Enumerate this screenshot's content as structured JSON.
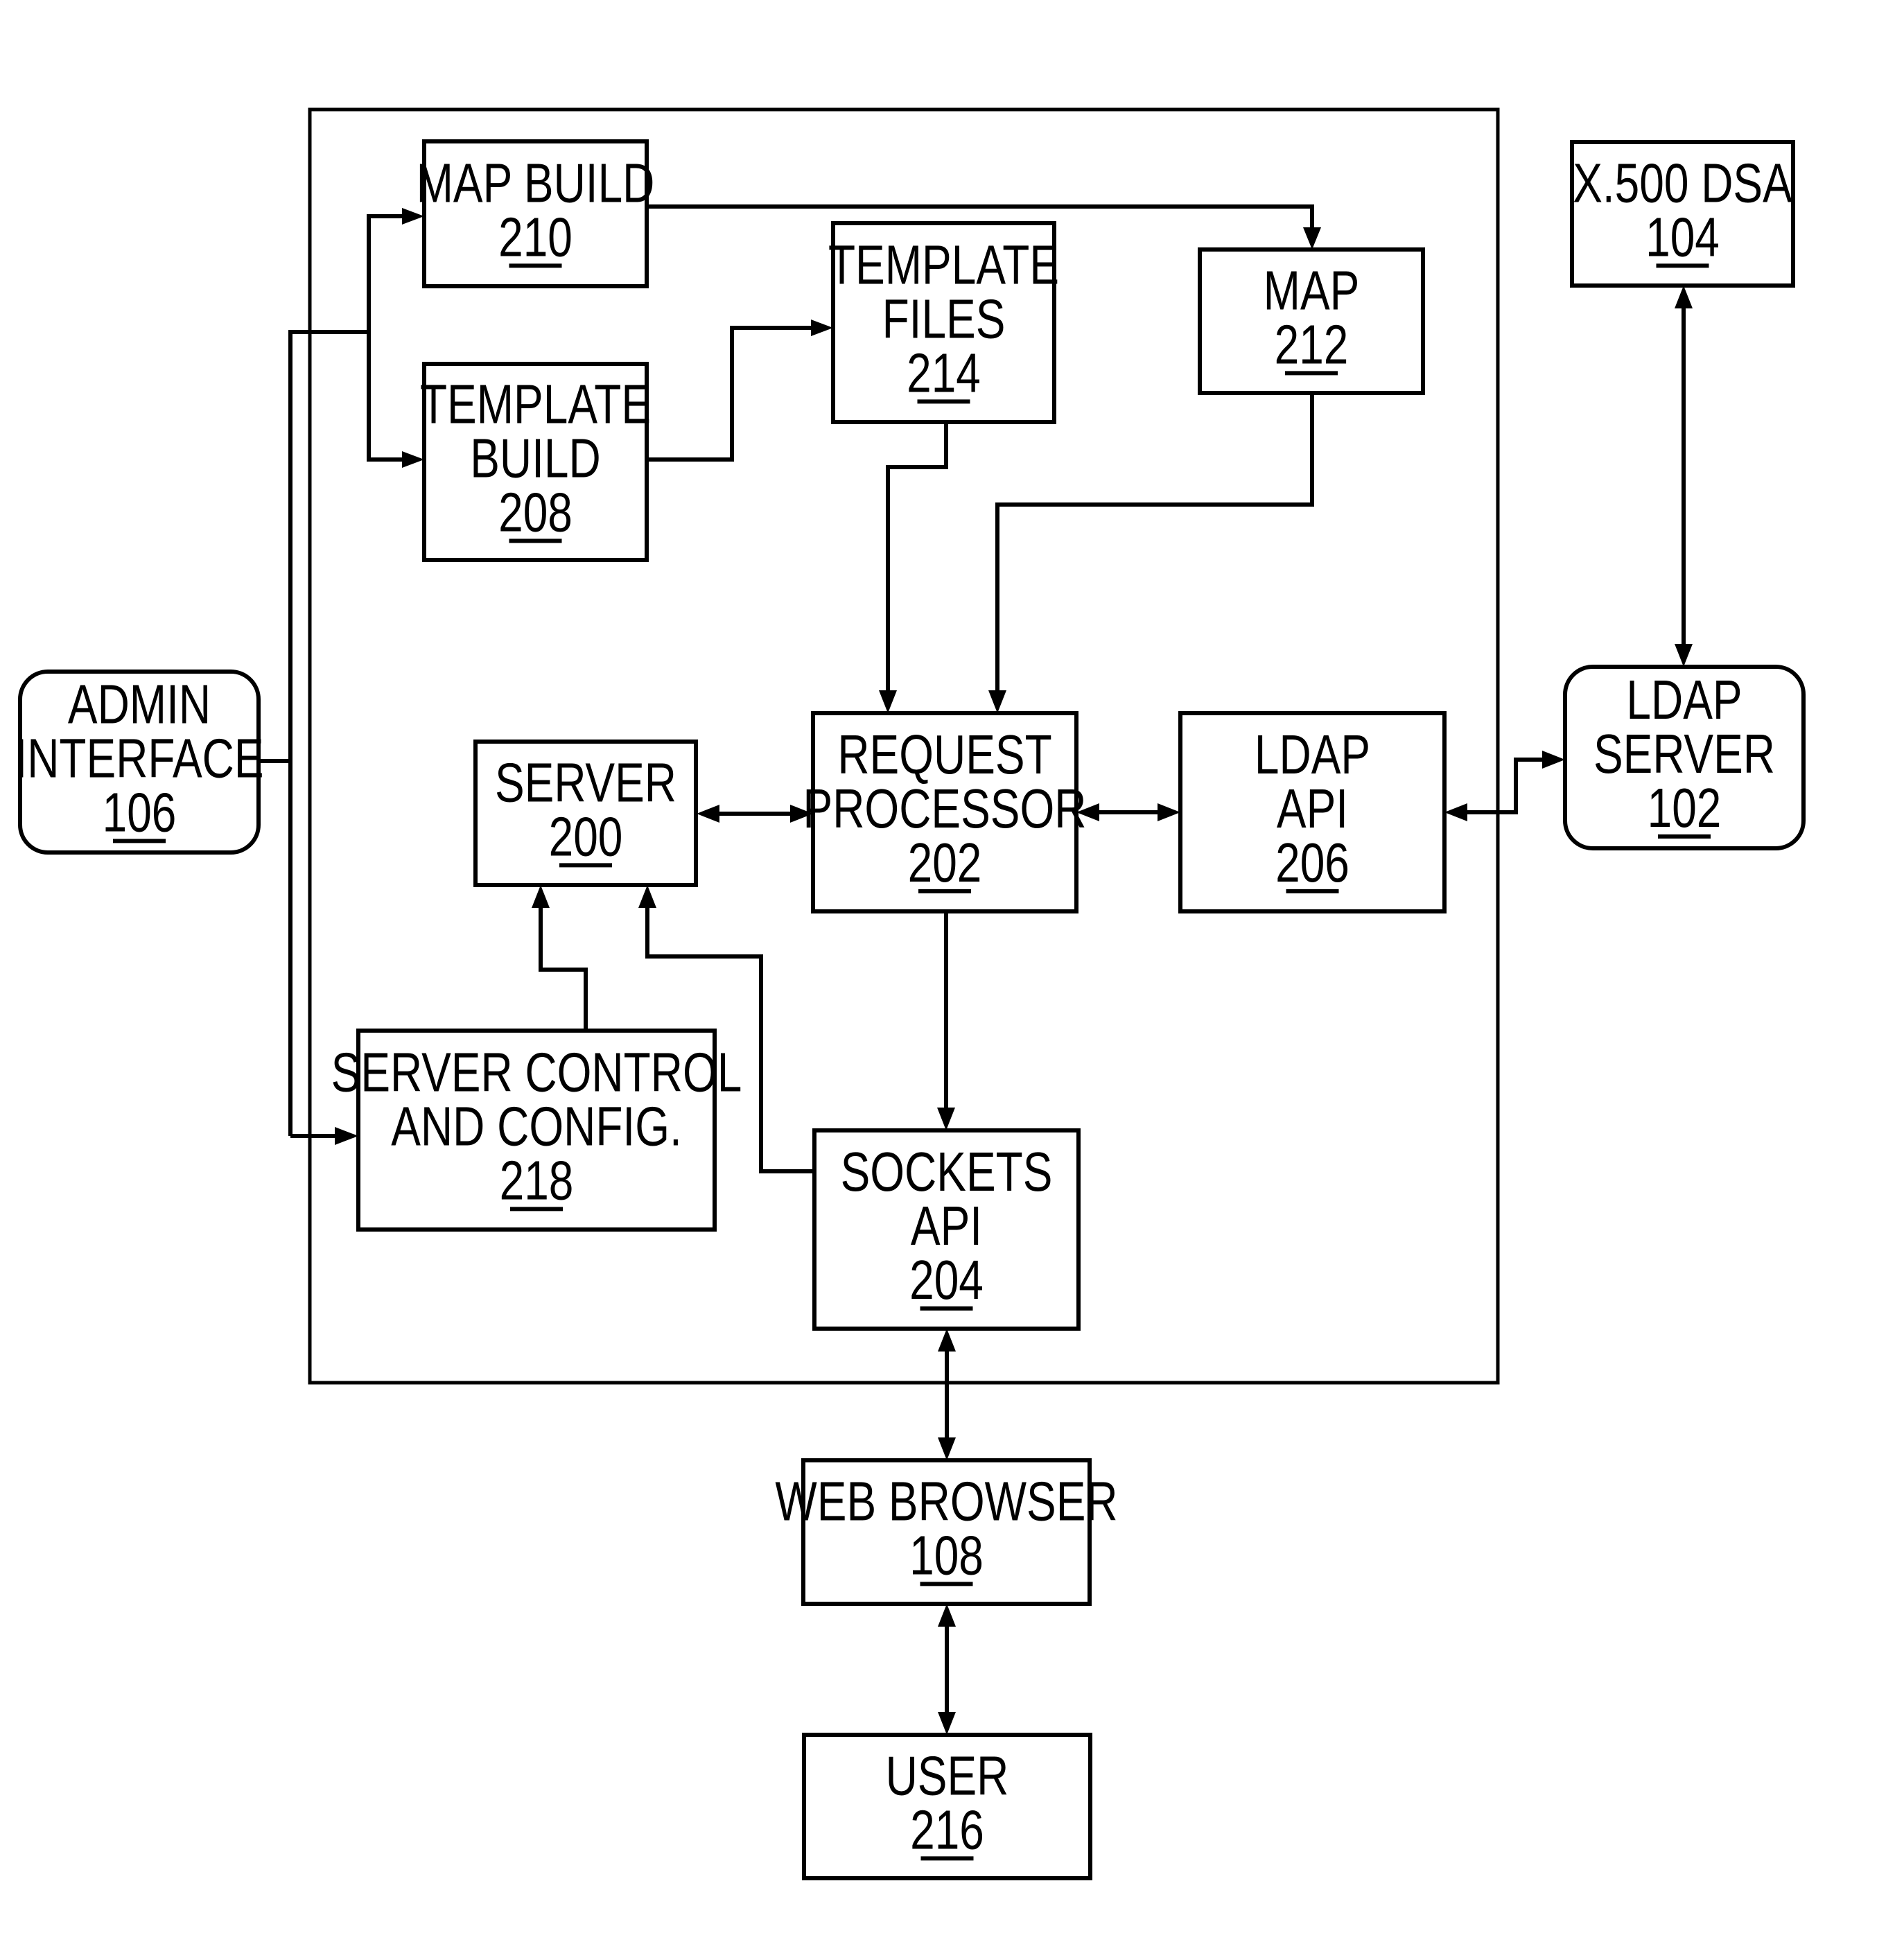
{
  "diagram": {
    "type": "block-diagram",
    "blocks": [
      {
        "id": "map_build",
        "lines": [
          "MAP BUILD"
        ],
        "ref": "210",
        "shape": "rect"
      },
      {
        "id": "template_build",
        "lines": [
          "TEMPLATE",
          "BUILD"
        ],
        "ref": "208",
        "shape": "rect"
      },
      {
        "id": "template_files",
        "lines": [
          "TEMPLATE",
          "FILES"
        ],
        "ref": "214",
        "shape": "rect"
      },
      {
        "id": "map",
        "lines": [
          "MAP"
        ],
        "ref": "212",
        "shape": "rect"
      },
      {
        "id": "x500_dsa",
        "lines": [
          "X.500 DSA"
        ],
        "ref": "104",
        "shape": "rect"
      },
      {
        "id": "admin_interface",
        "lines": [
          "ADMIN",
          "INTERFACE"
        ],
        "ref": "106",
        "shape": "rounded"
      },
      {
        "id": "server",
        "lines": [
          "SERVER"
        ],
        "ref": "200",
        "shape": "rect"
      },
      {
        "id": "request_processor",
        "lines": [
          "REQUEST",
          "PROCESSOR"
        ],
        "ref": "202",
        "shape": "rect"
      },
      {
        "id": "ldap_api",
        "lines": [
          "LDAP",
          "API"
        ],
        "ref": "206",
        "shape": "rect"
      },
      {
        "id": "ldap_server",
        "lines": [
          "LDAP",
          "SERVER"
        ],
        "ref": "102",
        "shape": "rounded"
      },
      {
        "id": "server_control",
        "lines": [
          "SERVER CONTROL",
          "AND CONFIG."
        ],
        "ref": "218",
        "shape": "rect"
      },
      {
        "id": "sockets_api",
        "lines": [
          "SOCKETS",
          "API"
        ],
        "ref": "204",
        "shape": "rect"
      },
      {
        "id": "web_browser",
        "lines": [
          "WEB BROWSER"
        ],
        "ref": "108",
        "shape": "rect"
      },
      {
        "id": "user",
        "lines": [
          "USER"
        ],
        "ref": "216",
        "shape": "rect"
      }
    ],
    "connections": [
      {
        "from": "admin_interface",
        "to": "map_build",
        "direction": "forward"
      },
      {
        "from": "admin_interface",
        "to": "template_build",
        "direction": "forward"
      },
      {
        "from": "admin_interface",
        "to": "server_control",
        "direction": "forward"
      },
      {
        "from": "map_build",
        "to": "map",
        "direction": "forward"
      },
      {
        "from": "template_build",
        "to": "template_files",
        "direction": "forward"
      },
      {
        "from": "template_files",
        "to": "request_processor",
        "direction": "forward"
      },
      {
        "from": "map",
        "to": "request_processor",
        "direction": "forward"
      },
      {
        "from": "server",
        "to": "request_processor",
        "direction": "bidirectional"
      },
      {
        "from": "request_processor",
        "to": "ldap_api",
        "direction": "bidirectional"
      },
      {
        "from": "ldap_api",
        "to": "ldap_server",
        "direction": "bidirectional"
      },
      {
        "from": "x500_dsa",
        "to": "ldap_server",
        "direction": "bidirectional"
      },
      {
        "from": "server_control",
        "to": "server",
        "direction": "forward"
      },
      {
        "from": "sockets_api",
        "to": "server",
        "direction": "forward"
      },
      {
        "from": "request_processor",
        "to": "sockets_api",
        "direction": "forward"
      },
      {
        "from": "sockets_api",
        "to": "web_browser",
        "direction": "bidirectional"
      },
      {
        "from": "web_browser",
        "to": "user",
        "direction": "bidirectional"
      }
    ]
  }
}
